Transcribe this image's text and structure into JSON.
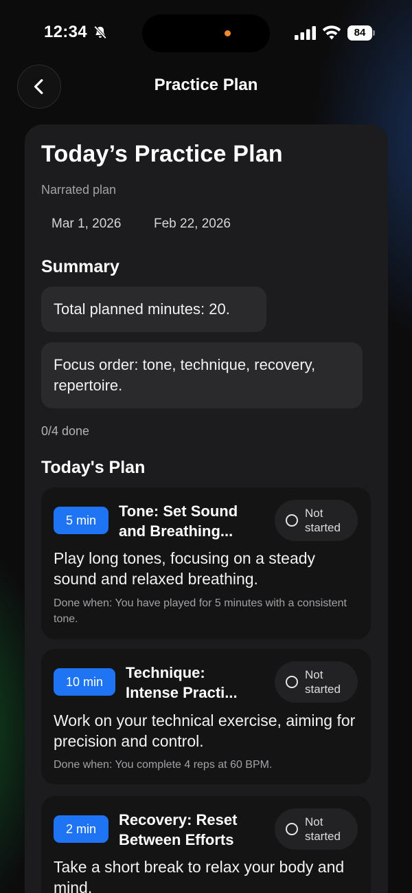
{
  "status_bar": {
    "time": "12:34",
    "battery": "84",
    "icons": [
      "bell-slash-icon",
      "cellular-signal-icon",
      "wifi-icon",
      "battery-icon"
    ],
    "island_dot_color": "#f08a2c"
  },
  "nav": {
    "title": "Practice Plan",
    "back_icon": "chevron-left-icon"
  },
  "plan": {
    "title": "Today’s Practice Plan",
    "subtitle": "Narrated plan",
    "dates": [
      "Mar 1, 2026",
      "Feb 22, 2026"
    ],
    "summary_heading": "Summary",
    "summary_items": [
      "Total planned minutes: 20.",
      "Focus order: tone, technique, recovery, repertoire."
    ],
    "progress": "0/4 done",
    "plan_heading": "Today's Plan",
    "tasks": [
      {
        "duration": "5 min",
        "title_line1": "Tone: Set Sound",
        "title_line2": "and Breathing...",
        "status": "Not\nstarted",
        "description": "Play long tones, focusing on a steady sound and relaxed breathing.",
        "done_when": "Done when: You have played for 5 minutes with a consistent tone."
      },
      {
        "duration": "10 min",
        "title_line1": "Technique:",
        "title_line2": "Intense Practi...",
        "status": "Not\nstarted",
        "description": "Work on your technical exercise, aiming for precision and control.",
        "done_when": "Done when: You complete 4 reps at 60 BPM."
      },
      {
        "duration": "2 min",
        "title_line1": "Recovery: Reset",
        "title_line2": "Between Efforts",
        "status": "Not\nstarted",
        "description": "Take a short break to relax your body and mind.",
        "done_when": ""
      }
    ]
  },
  "colors": {
    "accent_blue": "#1f74f4",
    "panel_bg": "#1c1c1e",
    "card_bg": "#141415"
  }
}
